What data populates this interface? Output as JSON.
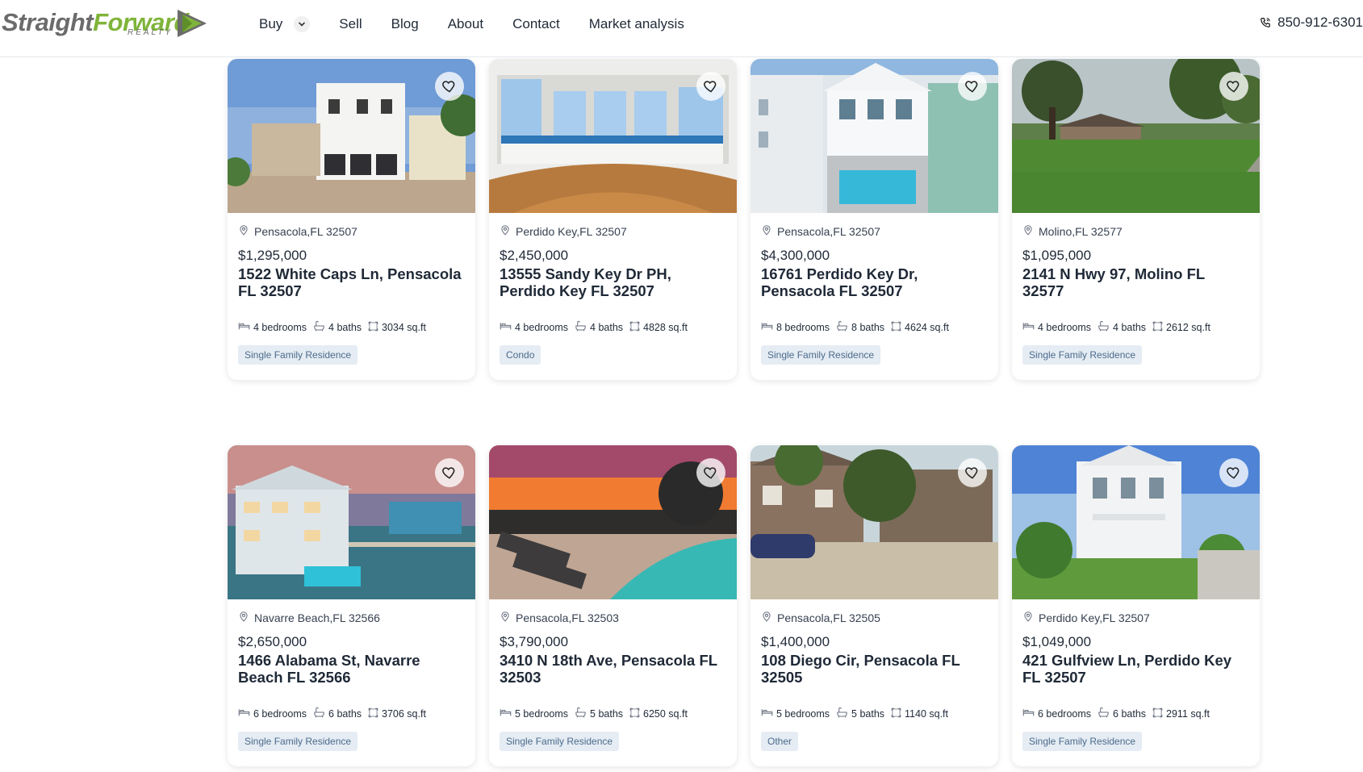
{
  "header": {
    "logo": {
      "part1": "Straight",
      "part2": "Forward",
      "sub": "REALTY"
    },
    "nav": [
      {
        "label": "Buy"
      },
      {
        "label": "Sell"
      },
      {
        "label": "Blog"
      },
      {
        "label": "About"
      },
      {
        "label": "Contact"
      },
      {
        "label": "Market analysis"
      }
    ],
    "phone": "850-912-6301"
  },
  "listings": [
    {
      "location": "Pensacola,FL 32507",
      "price": "$1,295,000",
      "address": "1522 White Caps Ln, Pensacola FL 32507",
      "bedrooms": "4 bedrooms",
      "baths": "4 baths",
      "sqft": "3034 sq.ft",
      "type": "Single Family Residence",
      "scene": "white-townhouse"
    },
    {
      "location": "Perdido Key,FL 32507",
      "price": "$2,450,000",
      "address": "13555 Sandy Key Dr PH, Perdido Key FL 32507",
      "bedrooms": "4 bedrooms",
      "baths": "4 baths",
      "sqft": "4828 sq.ft",
      "type": "Condo",
      "scene": "interior-ocean-view"
    },
    {
      "location": "Pensacola,FL 32507",
      "price": "$4,300,000",
      "address": "16761 Perdido Key Dr, Pensacola FL 32507",
      "bedrooms": "8 bedrooms",
      "baths": "8 baths",
      "sqft": "4624 sq.ft",
      "type": "Single Family Residence",
      "scene": "house-with-pool"
    },
    {
      "location": "Molino,FL 32577",
      "price": "$1,095,000",
      "address": "2141 N Hwy 97, Molino FL 32577",
      "bedrooms": "4 bedrooms",
      "baths": "4 baths",
      "sqft": "2612 sq.ft",
      "type": "Single Family Residence",
      "scene": "green-field"
    },
    {
      "location": "Navarre Beach,FL 32566",
      "price": "$2,650,000",
      "address": "1466 Alabama St, Navarre Beach FL 32566",
      "bedrooms": "6 bedrooms",
      "baths": "6 baths",
      "sqft": "3706 sq.ft",
      "type": "Single Family Residence",
      "scene": "waterfront-dusk"
    },
    {
      "location": "Pensacola,FL 32503",
      "price": "$3,790,000",
      "address": "3410 N 18th Ave, Pensacola FL 32503",
      "bedrooms": "5 bedrooms",
      "baths": "5 baths",
      "sqft": "6250 sq.ft",
      "type": "Single Family Residence",
      "scene": "sunset-beach"
    },
    {
      "location": "Pensacola,FL 32505",
      "price": "$1,400,000",
      "address": "108 Diego Cir, Pensacola FL 32505",
      "bedrooms": "5 bedrooms",
      "baths": "5 baths",
      "sqft": "1140 sq.ft",
      "type": "Other",
      "scene": "brick-house"
    },
    {
      "location": "Perdido Key,FL 32507",
      "price": "$1,049,000",
      "address": "421 Gulfview Ln, Perdido Key FL 32507",
      "bedrooms": "6 bedrooms",
      "baths": "6 baths",
      "sqft": "2911 sq.ft",
      "type": "Single Family Residence",
      "scene": "white-beach-house"
    }
  ],
  "colors": {
    "accent": "#7fb43a",
    "tag_bg": "#e5ecf3",
    "tag_text": "#4b6b8c"
  }
}
